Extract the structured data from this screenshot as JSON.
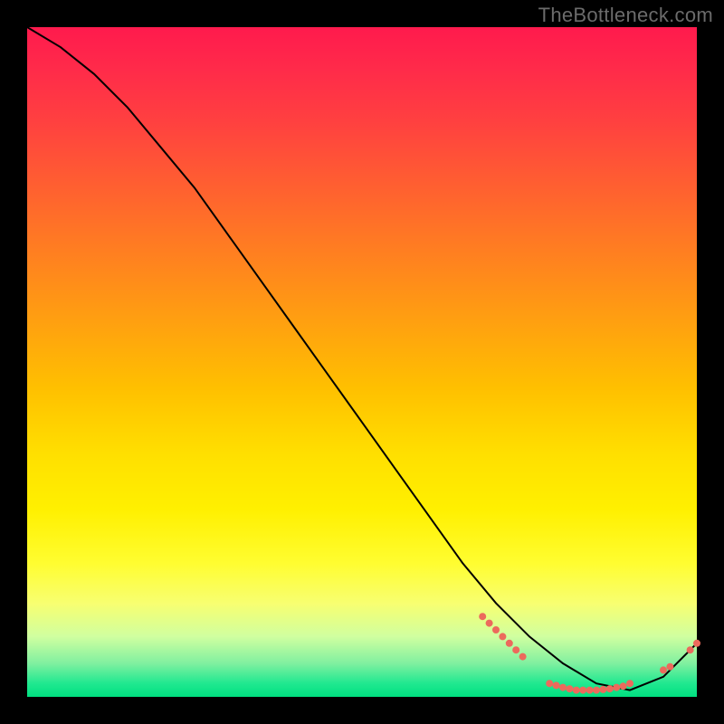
{
  "watermark": "TheBottleneck.com",
  "chart_data": {
    "type": "line",
    "title": "",
    "xlabel": "",
    "ylabel": "",
    "xlim": [
      0,
      100
    ],
    "ylim": [
      0,
      100
    ],
    "grid": false,
    "legend": false,
    "series": [
      {
        "name": "curve",
        "style": "line",
        "color": "#000000",
        "x": [
          0,
          5,
          10,
          15,
          20,
          25,
          30,
          35,
          40,
          45,
          50,
          55,
          60,
          65,
          70,
          75,
          80,
          85,
          90,
          95,
          100
        ],
        "y": [
          100,
          97,
          93,
          88,
          82,
          76,
          69,
          62,
          55,
          48,
          41,
          34,
          27,
          20,
          14,
          9,
          5,
          2,
          1,
          3,
          8
        ]
      },
      {
        "name": "mid-segment-dots",
        "style": "dots",
        "color": "#ec6a5c",
        "size": 4,
        "x": [
          68,
          69,
          70,
          71,
          72,
          73,
          74
        ],
        "y": [
          12,
          11,
          10,
          9,
          8,
          7,
          6
        ]
      },
      {
        "name": "bottom-cluster-dots",
        "style": "dots",
        "color": "#ec6a5c",
        "size": 4,
        "x": [
          78,
          79,
          80,
          81,
          82,
          83,
          84,
          85,
          86,
          87,
          88,
          89,
          90
        ],
        "y": [
          2,
          1.7,
          1.4,
          1.2,
          1.0,
          1.0,
          1.0,
          1.0,
          1.1,
          1.2,
          1.4,
          1.6,
          2
        ]
      },
      {
        "name": "tail-dots",
        "style": "dots",
        "color": "#ec6a5c",
        "size": 4,
        "x": [
          95,
          96,
          99,
          100
        ],
        "y": [
          4,
          4.5,
          7,
          8
        ]
      },
      {
        "name": "bottom-label",
        "style": "text",
        "color": "#ec6a5c",
        "text": "",
        "x": 84,
        "y": 3
      }
    ]
  }
}
